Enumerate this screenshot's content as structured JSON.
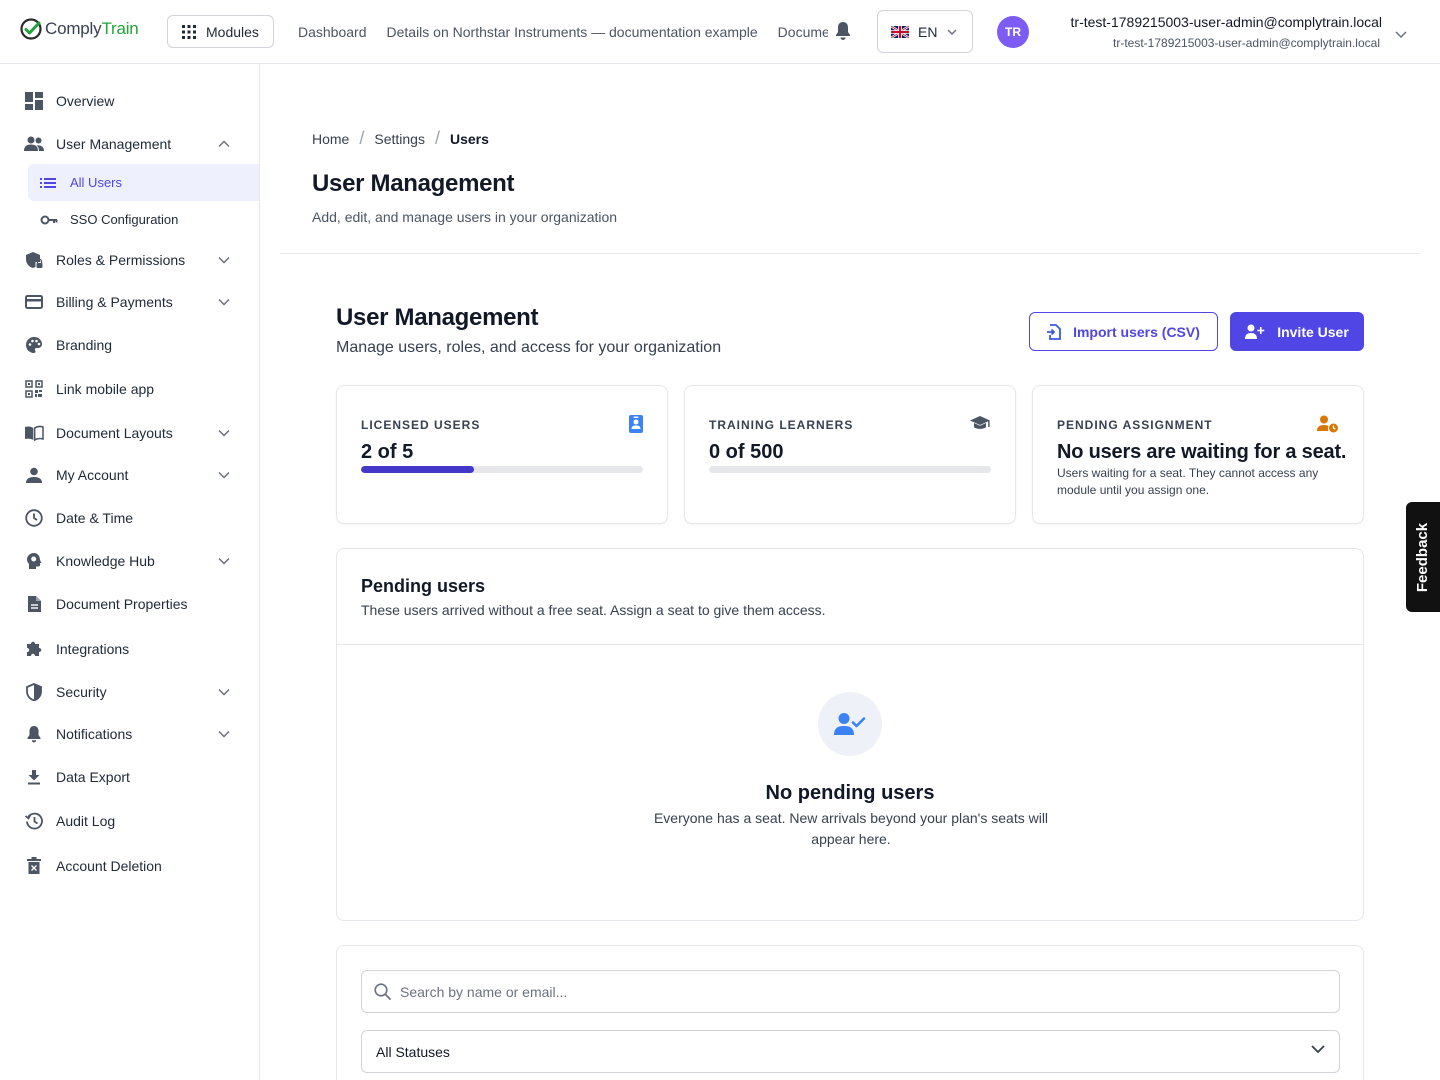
{
  "app": {
    "logo_prefix": "Comply",
    "logo_accent": "Train"
  },
  "topbar": {
    "modules_label": "Modules",
    "nav": [
      "Dashboard",
      "Details on Northstar Instruments — documentation example",
      "Documentation"
    ],
    "language": "EN",
    "avatar_initials": "TR",
    "user_name": "tr-test-1789215003-user-admin@complytrain.local",
    "user_email": "tr-test-1789215003-user-admin@complytrain.local"
  },
  "sidebar": {
    "items": [
      {
        "label": "Overview"
      },
      {
        "label": "User Management"
      },
      {
        "label": "All Users"
      },
      {
        "label": "SSO Configuration"
      },
      {
        "label": "Roles & Permissions"
      },
      {
        "label": "Billing & Payments"
      },
      {
        "label": "Branding"
      },
      {
        "label": "Link mobile app"
      },
      {
        "label": "Document Layouts"
      },
      {
        "label": "My Account"
      },
      {
        "label": "Date & Time"
      },
      {
        "label": "Knowledge Hub"
      },
      {
        "label": "Document Properties"
      },
      {
        "label": "Integrations"
      },
      {
        "label": "Security"
      },
      {
        "label": "Notifications"
      },
      {
        "label": "Data Export"
      },
      {
        "label": "Audit Log"
      },
      {
        "label": "Account Deletion"
      }
    ]
  },
  "header": {
    "breadcrumb": [
      "Home",
      "Settings",
      "Users"
    ],
    "title": "User Management",
    "subtitle": "Add, edit, and manage users in your organization"
  },
  "section": {
    "title": "User Management",
    "subtitle": "Manage users, roles, and access for your organization",
    "import_label": "Import users (CSV)",
    "invite_label": "Invite User"
  },
  "cards": {
    "licensed": {
      "label": "LICENSED USERS",
      "value": "2 of 5",
      "used": 2,
      "total": 5
    },
    "training": {
      "label": "TRAINING LEARNERS",
      "value": "0 of 500",
      "used": 0,
      "total": 500
    },
    "pending": {
      "label": "PENDING ASSIGNMENT",
      "title": "No users are waiting for a seat.",
      "desc": "Users waiting for a seat. They cannot access any module until you assign one."
    }
  },
  "pending_users": {
    "title": "Pending users",
    "subtitle": "These users arrived without a free seat. Assign a seat to give them access.",
    "empty_title": "No pending users",
    "empty_desc": "Everyone has a seat. New arrivals beyond your plan's seats will appear here."
  },
  "filters": {
    "search_placeholder": "Search by name or email...",
    "status_selected": "All Statuses"
  },
  "feedback_label": "Feedback",
  "colors": {
    "primary": "#4f46e5",
    "brand_green": "#22a33a",
    "avatar": "#7c5cf2",
    "warning": "#d97706",
    "info": "#3b82f6"
  }
}
